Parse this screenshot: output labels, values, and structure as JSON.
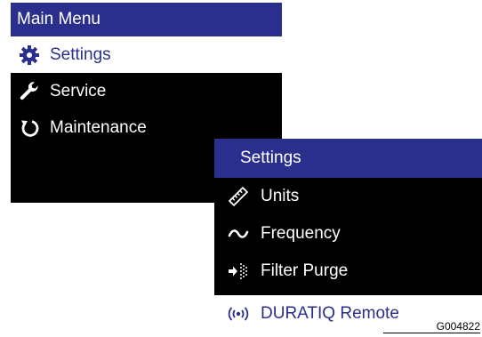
{
  "main_menu": {
    "title": "Main Menu",
    "items": [
      {
        "label": "Settings",
        "icon": "gear-icon",
        "selected": true
      },
      {
        "label": "Service",
        "icon": "wrench-icon",
        "selected": false
      },
      {
        "label": "Maintenance",
        "icon": "refresh-icon",
        "selected": false
      }
    ]
  },
  "settings_menu": {
    "title": "Settings",
    "items": [
      {
        "label": "Units",
        "icon": "ruler-icon"
      },
      {
        "label": "Frequency",
        "icon": "tilde-icon"
      },
      {
        "label": "Filter Purge",
        "icon": "filter-purge-icon"
      }
    ],
    "next_item": {
      "label": "DURATIQ Remote",
      "icon": "wireless-icon"
    }
  },
  "figure_code": "G004822",
  "colors": {
    "header": "#2a2f8e",
    "highlight_text": "#2a2f8e",
    "background": "#000000"
  }
}
